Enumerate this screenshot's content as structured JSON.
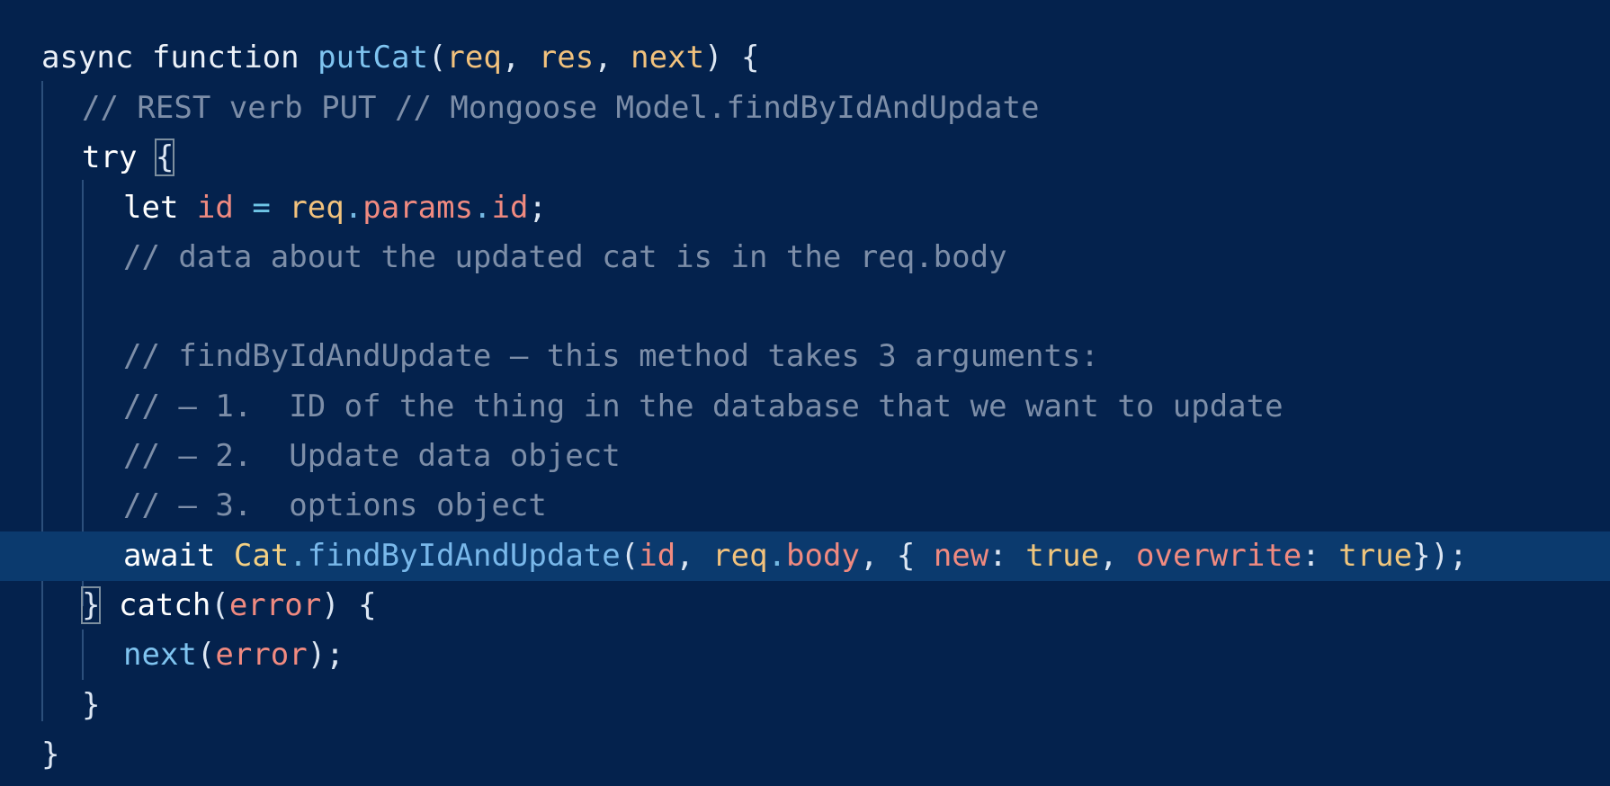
{
  "colors": {
    "background": "#04224d",
    "highlight_line": "#0b3a6e",
    "comment": "#7d8ea8",
    "keyword": "#ffffff",
    "function": "#7fc4f0",
    "parameter": "#f2c27d",
    "variable": "#f08a80",
    "literal": "#f0c67d"
  },
  "code": {
    "line1": {
      "async": "async",
      "function": "function",
      "name": "putCat",
      "open": "(",
      "req": "req",
      "c1": ", ",
      "res": "res",
      "c2": ", ",
      "next": "next",
      "close": ") {"
    },
    "line2": {
      "comment": "// REST verb PUT // Mongoose Model.findByIdAndUpdate"
    },
    "line3": {
      "try": "try",
      "brace": "{"
    },
    "line4": {
      "let": "let",
      "id": "id",
      "eq": "=",
      "req": "req",
      "dot1": ".",
      "params": "params",
      "dot2": ".",
      "prop_id": "id",
      "semi": ";"
    },
    "line5": {
      "comment": "// data about the updated cat is in the req.body"
    },
    "line7": {
      "comment": "// findByIdAndUpdate – this method takes 3 arguments:"
    },
    "line8": {
      "comment": "// – 1.  ID of the thing in the database that we want to update"
    },
    "line9": {
      "comment": "// – 2.  Update data object"
    },
    "line10": {
      "comment": "// – 3.  options object"
    },
    "line11": {
      "await": "await",
      "cls": "Cat",
      "dot1": ".",
      "method": "findByIdAndUpdate",
      "open": "(",
      "id": "id",
      "c1": ", ",
      "req": "req",
      "dot2": ".",
      "body": "body",
      "c2": ", { ",
      "new": "new",
      "colon1": ": ",
      "true1": "true",
      "c3": ", ",
      "overwrite": "overwrite",
      "colon2": ": ",
      "true2": "true",
      "close": "});"
    },
    "line12": {
      "brace": "}",
      "catch": "catch",
      "open": "(",
      "error": "error",
      "close": ") {"
    },
    "line13": {
      "next": "next",
      "open": "(",
      "error": "error",
      "close": ");"
    },
    "line14": {
      "brace": "}"
    },
    "line15": {
      "brace": "}"
    }
  }
}
